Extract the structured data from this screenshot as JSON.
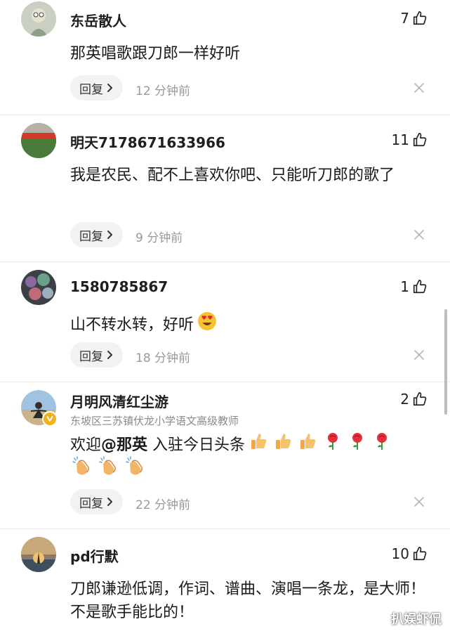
{
  "reply_label": "回复",
  "comments": [
    {
      "username": "东岳散人",
      "likes": "7",
      "text": "那英唱歌跟刀郎一样好听",
      "time": "12 分钟前"
    },
    {
      "username": "明天7178671633966",
      "likes": "11",
      "text": "我是农民、配不上喜欢你吧、只能听刀郎的歌了",
      "time": "9 分钟前"
    },
    {
      "username": "1580785867",
      "likes": "1",
      "text": "山不转水转，好听",
      "time": "18 分钟前"
    },
    {
      "username": "月明风清红尘游",
      "subtitle": "东坡区三苏镇伏龙小学语文高级教师",
      "likes": "2",
      "text_prefix": "欢迎",
      "mention": "@那英",
      "text_suffix": " 入驻今日头条",
      "time": "22 分钟前"
    },
    {
      "username": "pd行默",
      "likes": "10",
      "text": "刀郎谦逊低调，作词、谱曲、演唱一条龙，是大师！不是歌手能比的！"
    }
  ],
  "watermark": "扒娱虾侃",
  "colors": {
    "reply_bg": "#f2f2f2",
    "time_text": "#999999",
    "verified_badge": "#f2b01e"
  }
}
